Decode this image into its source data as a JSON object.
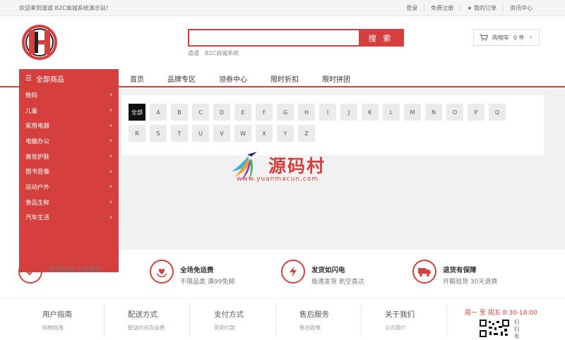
{
  "topbar": {
    "welcome": "欢迎来到道道 B2C商城系统演示站！",
    "links": [
      "登录",
      "免费注册",
      "我的订单",
      "资讯中心"
    ]
  },
  "search": {
    "placeholder": "",
    "button": "搜 索",
    "hotwords": [
      "道道",
      "B2C商城系统"
    ]
  },
  "cart": {
    "label": "购物车",
    "count": "0 件"
  },
  "nav": {
    "all_categories": "全部商品",
    "items": [
      "首页",
      "品牌专区",
      "领券中心",
      "限时折扣",
      "限时拼团"
    ]
  },
  "categories": [
    "数码",
    "儿童",
    "家用电器",
    "电脑办公",
    "美妆护肤",
    "图书音像",
    "运动户外",
    "食品生鲜",
    "汽车生活"
  ],
  "letters": {
    "active": "全部",
    "row1": [
      "A",
      "B",
      "C",
      "D",
      "E",
      "F",
      "G",
      "H",
      "I",
      "J",
      "K",
      "L",
      "M",
      "N",
      "O",
      "P",
      "Q"
    ],
    "row2": [
      "R",
      "S",
      "T",
      "U",
      "V",
      "W",
      "X",
      "Y",
      "Z"
    ]
  },
  "watermark": {
    "cn": "源码村",
    "en": "www.yuanmacun.com"
  },
  "features": [
    {
      "title": "",
      "desc": "现货自营 正品保证",
      "icon": "check-icon"
    },
    {
      "title": "全场免运费",
      "desc": "不限品类 满99免邮",
      "icon": "heart-hands-icon"
    },
    {
      "title": "发货如闪电",
      "desc": "极速发货 航空直达",
      "icon": "lightning-icon"
    },
    {
      "title": "退货有保障",
      "desc": "开箱验货 30天退换",
      "icon": "truck-icon"
    }
  ],
  "footer": {
    "cols": [
      {
        "title": "用户指南",
        "link": "购物指南"
      },
      {
        "title": "配送方式",
        "link": "配送时间及运费"
      },
      {
        "title": "支付方式",
        "link": "货到付款"
      },
      {
        "title": "售后服务",
        "link": "售后政策"
      },
      {
        "title": "关于我们",
        "link": "公司简介"
      }
    ],
    "hours": "周一 至 周五  8:30-18:00",
    "scan": "扫扫有"
  },
  "colors": {
    "accent": "#d5403e"
  }
}
